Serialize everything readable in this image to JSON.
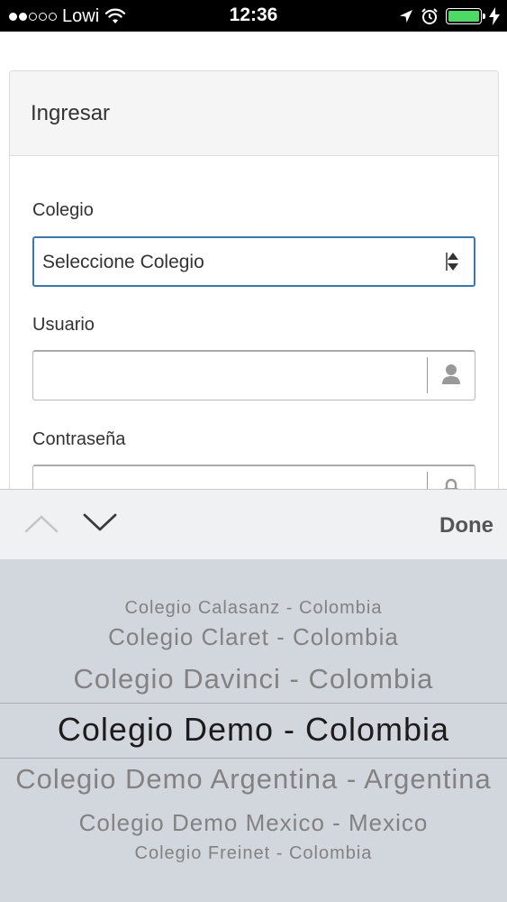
{
  "status_bar": {
    "carrier": "Lowi",
    "signal_bars_filled": 2,
    "signal_bars_total": 5,
    "time": "12:36",
    "battery_color": "#4cd964"
  },
  "card": {
    "title": "Ingresar",
    "school_label": "Colegio",
    "school_select_value": "Seleccione Colegio",
    "user_label": "Usuario",
    "user_value": "",
    "password_label": "Contraseña",
    "password_value": ""
  },
  "accessory": {
    "done_label": "Done"
  },
  "picker": {
    "options": [
      "Colegio Calasanz - Colombia",
      "Colegio Claret - Colombia",
      "Colegio Davinci - Colombia",
      "Colegio Demo - Colombia",
      "Colegio Demo Argentina - Argentina",
      "Colegio Demo Mexico - Mexico",
      "Colegio Freinet - Colombia"
    ],
    "selected": "Colegio Demo - Colombia"
  },
  "colors": {
    "focus_border": "#337ab7",
    "picker_bg": "#d2d6dd",
    "card_header_bg": "#f5f5f5"
  },
  "icons": {
    "select": "up-down-arrows",
    "user": "person-icon",
    "password": "lock-icon",
    "prev": "chevron-up-icon",
    "next": "chevron-down-icon"
  }
}
